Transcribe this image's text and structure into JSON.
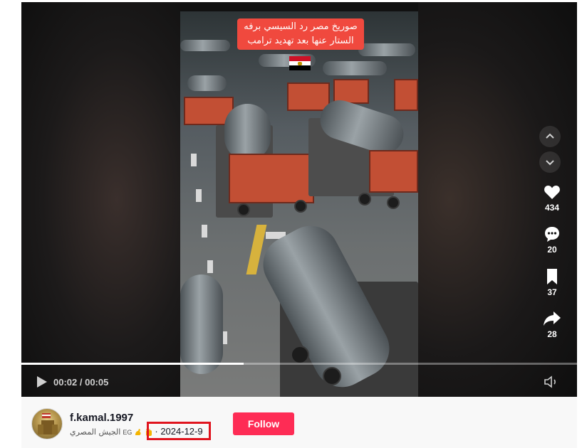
{
  "video": {
    "caption": "صوريخ مصر رد السيسي برفه الستار عنها بعد تهديد ترامب",
    "progress_fraction": 0.4,
    "current_time": "00:02",
    "total_time": "00:05",
    "time_separator": " / "
  },
  "actions": {
    "likes": "434",
    "comments": "20",
    "saves": "37",
    "shares": "28"
  },
  "author": {
    "username": "f.kamal.1997",
    "nickname": "الجيش المصري",
    "country": "EG",
    "date": "· 2024-12-9",
    "follow_label": "Follow"
  },
  "colors": {
    "follow_button": "#fe2c55",
    "caption_bg": "#f0493e",
    "highlight_box": "#e0141e"
  },
  "icons": [
    "play-icon",
    "volume-icon",
    "heart-icon",
    "comment-icon",
    "bookmark-icon",
    "share-icon",
    "chevron-up-icon",
    "chevron-down-icon",
    "egypt-flag-icon"
  ]
}
